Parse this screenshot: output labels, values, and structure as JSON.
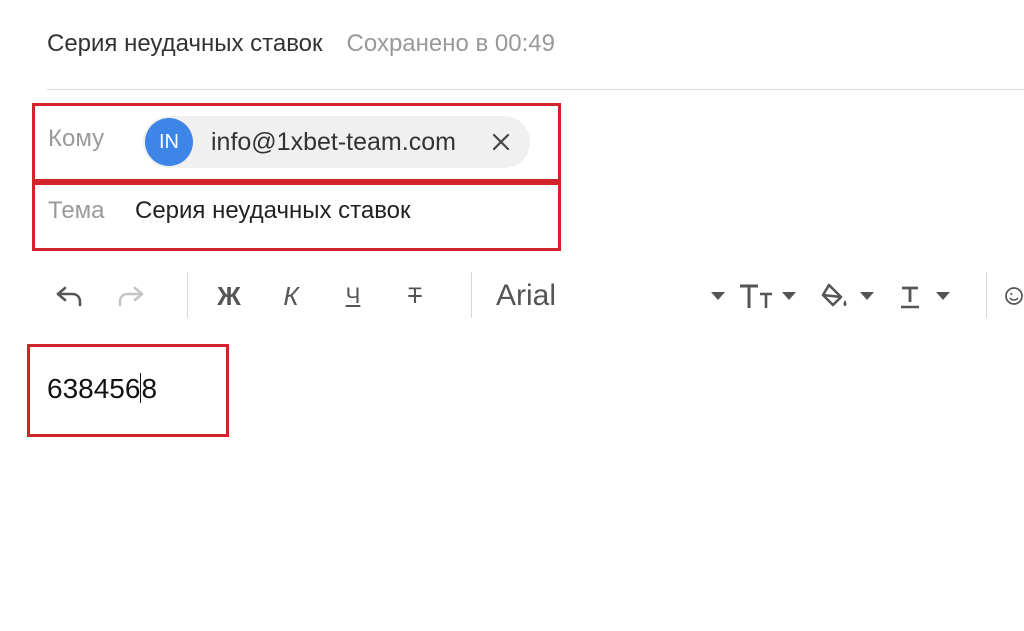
{
  "header": {
    "draft_title": "Серия неудачных ставок",
    "saved_status": "Сохранено в 00:49"
  },
  "to": {
    "label": "Кому",
    "recipients": [
      {
        "initials": "IN",
        "email": "info@1xbet-team.com",
        "avatar_color": "#3d86e8"
      }
    ]
  },
  "subject": {
    "label": "Тема",
    "value": "Серия неудачных ставок"
  },
  "toolbar": {
    "undo_icon": "undo-icon",
    "redo_icon": "redo-icon",
    "bold_label": "Ж",
    "italic_label": "К",
    "underline_label": "Ч",
    "strike_label": "Т",
    "font_family": "Arial",
    "font_size_icon": "font-size-icon",
    "fill_icon": "paint-bucket-icon",
    "text_color_icon": "text-color-icon",
    "emoji_icon": "emoji-icon"
  },
  "body": {
    "text_before_caret": "638456",
    "text_after_caret": "8"
  },
  "colors": {
    "highlight_border": "#d2232a",
    "avatar": "#3d86e8",
    "muted_text": "#999999"
  }
}
